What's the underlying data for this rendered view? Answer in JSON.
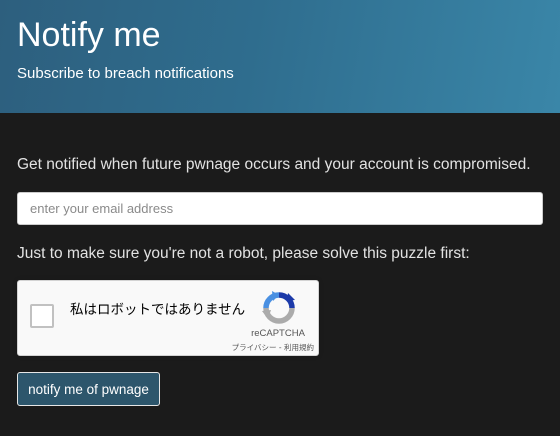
{
  "header": {
    "title": "Notify me",
    "subtitle": "Subscribe to breach notifications"
  },
  "form": {
    "intro_text": "Get notified when future pwnage occurs and your account is compromised.",
    "email_placeholder": "enter your email address",
    "email_value": "",
    "robot_text": "Just to make sure you're not a robot, please solve this puzzle first:",
    "submit_label": "notify me of pwnage"
  },
  "recaptcha": {
    "checkbox_label": "私はロボットではありません",
    "brand": "reCAPTCHA",
    "privacy_link": "プライバシー",
    "separator": " - ",
    "terms_link": "利用規約",
    "checked": false
  },
  "colors": {
    "page_background": "#1b1b1b",
    "header_gradient_start": "#2d5f7e",
    "header_gradient_end": "#3a86a8",
    "button_background": "#2d566c",
    "recaptcha_blue": "#4a90e2",
    "recaptcha_dark_blue": "#1c3aa9",
    "recaptcha_gray": "#ababab"
  },
  "icons": {
    "recaptcha_logo": "recaptcha-logo-icon",
    "checkbox": "checkbox-icon"
  }
}
